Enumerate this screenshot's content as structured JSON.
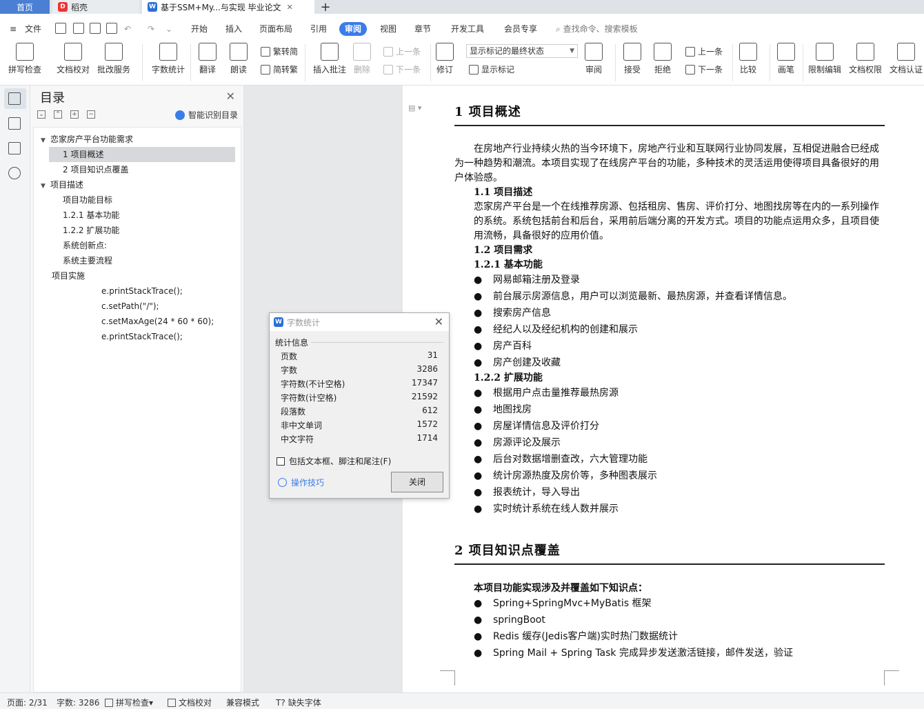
{
  "tabs": {
    "home": "首页",
    "daoke": "稻壳",
    "document": "基于SSM+My...与实现 毕业论文",
    "add": "+"
  },
  "menu": {
    "file": "文件",
    "items": [
      "开始",
      "插入",
      "页面布局",
      "引用",
      "审阅",
      "视图",
      "章节",
      "开发工具",
      "会员专享"
    ],
    "active": "审阅",
    "search_placeholder": "查找命令、搜索模板"
  },
  "ribbon": {
    "spellcheck": "拼写检查",
    "doc_proof": "文档校对",
    "correction_service": "批改服务",
    "word_count": "字数统计",
    "translate": "翻译",
    "read_aloud": "朗读",
    "to_traditional": "繁转简",
    "to_simplified": "简转繁",
    "insert_comment": "插入批注",
    "delete": "删除",
    "prev_comment": "上一条",
    "next_comment": "下一条",
    "revise": "修订",
    "markup_select": "显示标记的最终状态",
    "show_markup": "显示标记",
    "review": "审阅",
    "accept": "接受",
    "reject": "拒绝",
    "prev": "上一条",
    "next": "下一条",
    "compare": "比较",
    "pen": "画笔",
    "restrict_edit": "限制编辑",
    "doc_permission": "文档权限",
    "doc_certify": "文档认证"
  },
  "toc": {
    "title": "目录",
    "smart": "智能识别目录",
    "items": [
      {
        "label": "恋家房产平台功能需求",
        "level": 0,
        "expanded": true
      },
      {
        "label": "1   项目概述",
        "level": 1,
        "selected": true
      },
      {
        "label": "2   项目知识点覆盖",
        "level": 1
      },
      {
        "label": "项目描述",
        "level": 0,
        "expanded": true
      },
      {
        "label": "项目功能目标",
        "level": 1
      },
      {
        "label": "1.2.1  基本功能",
        "level": 1
      },
      {
        "label": "1.2.2  扩展功能",
        "level": 1
      },
      {
        "label": "系统创新点:",
        "level": 1
      },
      {
        "label": "系统主要流程",
        "level": 1
      },
      {
        "label": "项目实施",
        "level": 0
      },
      {
        "label": "e.printStackTrace();",
        "level": 2
      },
      {
        "label": "c.setPath(\"/\");",
        "level": 2
      },
      {
        "label": "c.setMaxAge(24 * 60 * 60);",
        "level": 2
      },
      {
        "label": "e.printStackTrace();",
        "level": 2
      }
    ]
  },
  "document": {
    "h1_1": "1    项目概述",
    "intro": "在房地产行业持续火热的当今环境下，房地产行业和互联网行业协同发展，互相促进融合已经成为一种趋势和潮流。本项目实现了在线房产平台的功能，多种技术的灵活运用使得项目具备很好的用户体验感。",
    "s11": "1.1  项目描述",
    "s11_text": "恋家房产平台是一个在线推荐房源、包括租房、售房、评价打分、地图找房等在内的一系列操作的系统。系统包括前台和后台，采用前后端分离的开发方式。项目的功能点运用众多，且项目使用流畅，具备很好的应用价值。",
    "s12": "1.2  项目需求",
    "s121": "1.2.1  基本功能",
    "basic": [
      "网易邮箱注册及登录",
      "前台展示房源信息，用户可以浏览最新、最热房源，并查看详情信息。",
      "搜索房产信息",
      "经纪人以及经纪机构的创建和展示",
      "房产百科",
      "房产创建及收藏"
    ],
    "s122": "1.2.2  扩展功能",
    "extended": [
      "根据用户点击量推荐最热房源",
      "地图找房",
      "房屋详情信息及评价打分",
      "房源评论及展示",
      "后台对数据增删查改，六大管理功能",
      "统计房源热度及房价等，多种图表展示",
      "报表统计，导入导出",
      "实时统计系统在线人数并展示"
    ],
    "h1_2": "2    项目知识点覆盖",
    "s2_intro": "本项目功能实现涉及并覆盖如下知识点：",
    "knowledge": [
      "Spring+SpringMvc+MyBatis 框架",
      "springBoot",
      "Redis 缓存(Jedis客户端)实时热门数据统计",
      "Spring Mail + Spring Task 完成异步发送激活链接，邮件发送，验证"
    ]
  },
  "dialog": {
    "title": "字数统计",
    "group": "统计信息",
    "stats": [
      {
        "label": "页数",
        "value": "31"
      },
      {
        "label": "字数",
        "value": "3286"
      },
      {
        "label": "字符数(不计空格)",
        "value": "17347"
      },
      {
        "label": "字符数(计空格)",
        "value": "21592"
      },
      {
        "label": "段落数",
        "value": "612"
      },
      {
        "label": "非中文单词",
        "value": "1572"
      },
      {
        "label": "中文字符",
        "value": "1714"
      }
    ],
    "checkbox": "包括文本框、脚注和尾注(F)",
    "tips": "操作技巧",
    "close": "关闭"
  },
  "status": {
    "page": "页面: 2/31",
    "words": "字数: 3286",
    "spellcheck": "拼写检查",
    "proof": "文档校对",
    "compat": "兼容模式",
    "missing_font": "缺失字体"
  }
}
